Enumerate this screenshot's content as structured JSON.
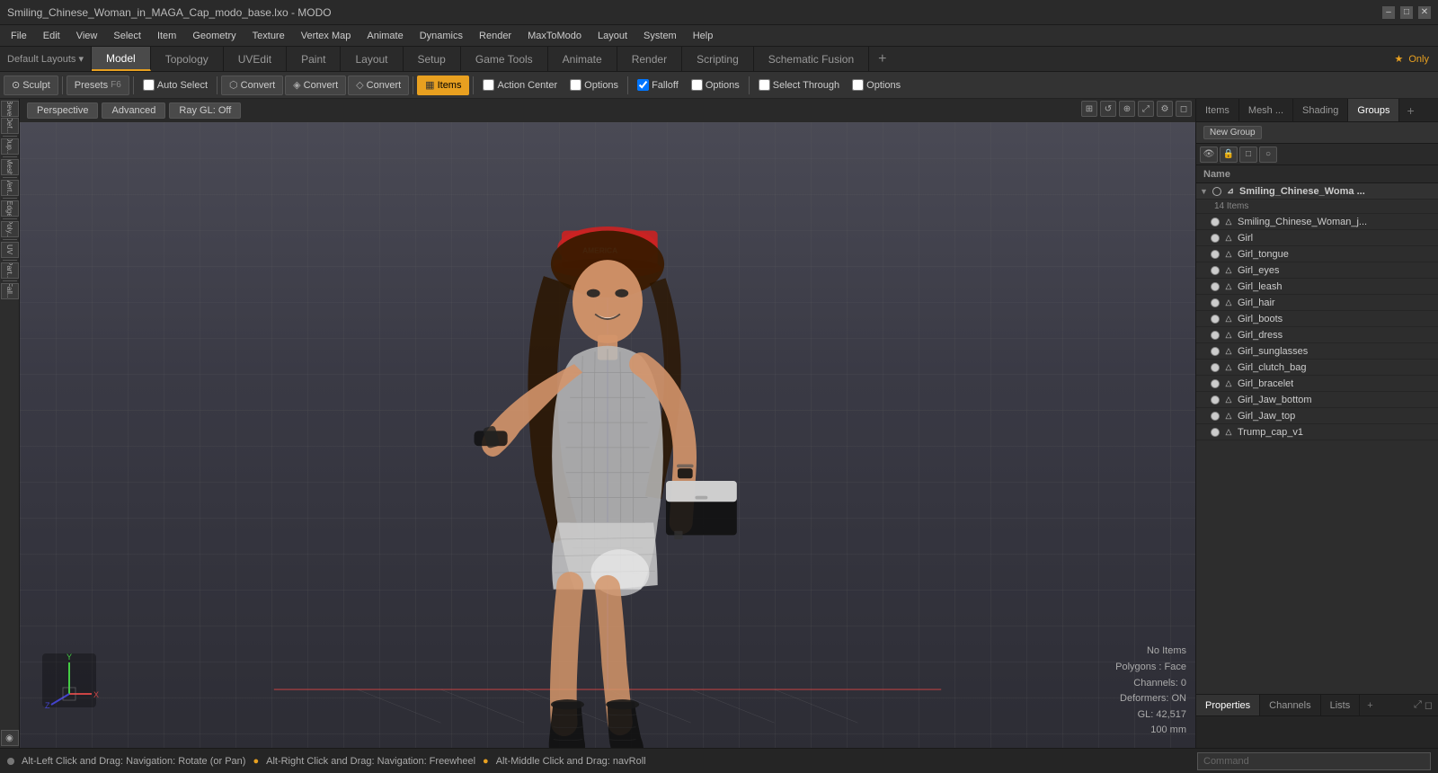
{
  "titleBar": {
    "title": "Smiling_Chinese_Woman_in_MAGA_Cap_modo_base.lxo - MODO",
    "minimizeLabel": "–",
    "maximizeLabel": "□",
    "closeLabel": "✕"
  },
  "menuBar": {
    "items": [
      "File",
      "Edit",
      "View",
      "Select",
      "Item",
      "Geometry",
      "Texture",
      "Vertex Map",
      "Animate",
      "Dynamics",
      "Render",
      "MaxToModo",
      "Layout",
      "System",
      "Help"
    ]
  },
  "tabs": {
    "items": [
      {
        "label": "Model",
        "active": true
      },
      {
        "label": "Topology",
        "active": false
      },
      {
        "label": "UVEdit",
        "active": false
      },
      {
        "label": "Paint",
        "active": false
      },
      {
        "label": "Layout",
        "active": false
      },
      {
        "label": "Setup",
        "active": false
      },
      {
        "label": "Game Tools",
        "active": false
      },
      {
        "label": "Animate",
        "active": false
      },
      {
        "label": "Render",
        "active": false
      },
      {
        "label": "Scripting",
        "active": false
      },
      {
        "label": "Schematic Fusion",
        "active": false
      }
    ],
    "plusLabel": "+",
    "rightLabel": "Only"
  },
  "toolbar": {
    "sculpt": "Sculpt",
    "presets": "Presets",
    "presetsShortcut": "F6",
    "autoSelect": "Auto Select",
    "convert1": "Convert",
    "convert2": "Convert",
    "convert3": "Convert",
    "items": "Items",
    "actionCenter": "Action Center",
    "optionsLabel1": "Options",
    "falloff": "Falloff",
    "optionsLabel2": "Options",
    "selectThrough": "Select Through",
    "optionsLabel3": "Options"
  },
  "viewport": {
    "tabs": [
      "Perspective",
      "Advanced",
      "Ray GL: Off"
    ],
    "stats": {
      "noItems": "No Items",
      "polygons": "Polygons : Face",
      "channels": "Channels: 0",
      "deformers": "Deformers: ON",
      "gl": "GL: 42,517",
      "distance": "100 mm"
    }
  },
  "statusBar": {
    "navText": "Alt-Left Click and Drag: Navigation: Rotate (or Pan)",
    "dot1": "●",
    "text2": "Alt-Right Click and Drag: Navigation: Freewheel",
    "dot2": "●",
    "text3": "Alt-Middle Click and Drag: navRoll",
    "commandPlaceholder": "Command"
  },
  "rightPanel": {
    "tabs": [
      "Items",
      "Mesh ...",
      "Shading",
      "Groups"
    ],
    "activeTab": "Groups",
    "newGroupLabel": "New Group",
    "sceneIcons": [
      "eye",
      "lock",
      "square",
      "circle"
    ],
    "colHeader": "Name",
    "sceneItems": [
      {
        "id": "group-root",
        "name": "Smiling_Chinese_Woma ...",
        "type": "group",
        "count": "14 Items",
        "expanded": true,
        "indent": 0
      },
      {
        "id": "item-main",
        "name": "Smiling_Chinese_Woman_j...",
        "type": "item",
        "indent": 1
      },
      {
        "id": "item-girl",
        "name": "Girl",
        "type": "item",
        "indent": 1
      },
      {
        "id": "item-tongue",
        "name": "Girl_tongue",
        "type": "item",
        "indent": 1
      },
      {
        "id": "item-eyes",
        "name": "Girl_eyes",
        "type": "item",
        "indent": 1
      },
      {
        "id": "item-leash",
        "name": "Girl_leash",
        "type": "item",
        "indent": 1
      },
      {
        "id": "item-hair",
        "name": "Girl_hair",
        "type": "item",
        "indent": 1
      },
      {
        "id": "item-boots",
        "name": "Girl_boots",
        "type": "item",
        "indent": 1
      },
      {
        "id": "item-dress",
        "name": "Girl_dress",
        "type": "item",
        "indent": 1
      },
      {
        "id": "item-sunglasses",
        "name": "Girl_sunglasses",
        "type": "item",
        "indent": 1
      },
      {
        "id": "item-clutch",
        "name": "Girl_clutch_bag",
        "type": "item",
        "indent": 1
      },
      {
        "id": "item-bracelet",
        "name": "Girl_bracelet",
        "type": "item",
        "indent": 1
      },
      {
        "id": "item-jaw-bottom",
        "name": "Girl_Jaw_bottom",
        "type": "item",
        "indent": 1
      },
      {
        "id": "item-jaw-top",
        "name": "Girl_Jaw_top",
        "type": "item",
        "indent": 1
      },
      {
        "id": "item-cap",
        "name": "Trump_cap_v1",
        "type": "item",
        "indent": 1
      }
    ]
  },
  "bottomRightPanel": {
    "tabs": [
      "Properties",
      "Channels",
      "Lists"
    ],
    "activeTab": "Properties",
    "plusLabel": "+"
  },
  "leftPanel": {
    "buttons": [
      "Bevel",
      "Deform",
      "Duplicate",
      "Mesh",
      "Vertex",
      "Edge",
      "Polygon",
      "UV",
      "Particles",
      "Falloff"
    ]
  },
  "colors": {
    "accent": "#e8a020",
    "activeTab": "#4a4a4a",
    "selected": "#3d5a80",
    "panelBg": "#2d2d2d",
    "viewportBg": "#3a3a3a"
  }
}
